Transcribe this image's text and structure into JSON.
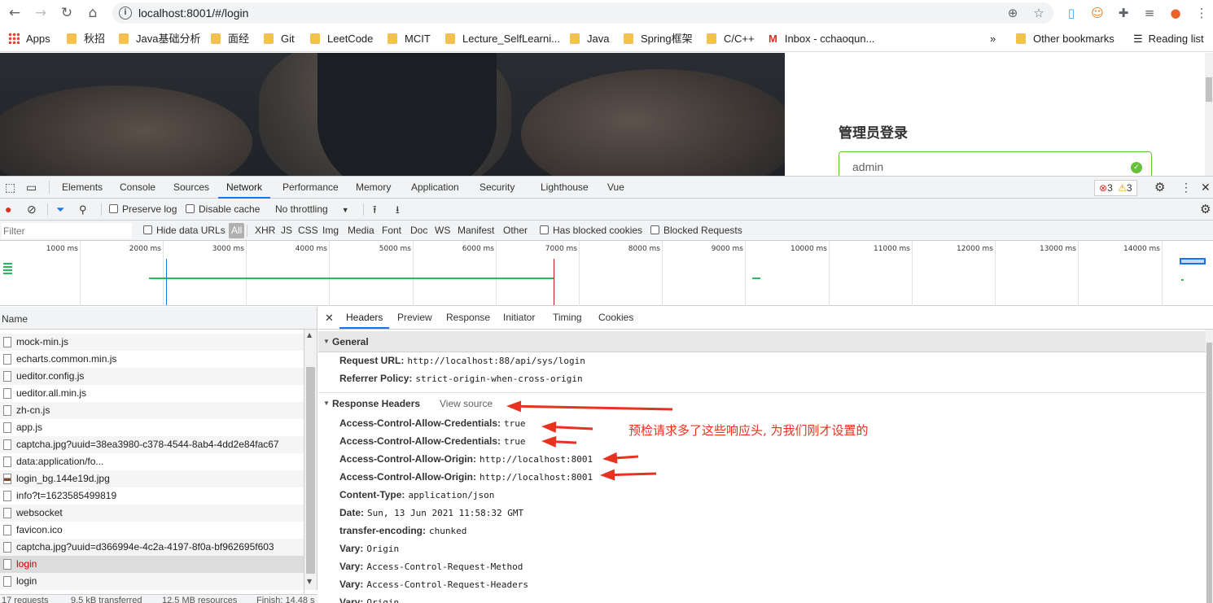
{
  "browser": {
    "url": "localhost:8001/#/login",
    "bookmarks": [
      "Apps",
      "秋招",
      "Java基础分析",
      "面经",
      "Git",
      "LeetCode",
      "MCIT",
      "Lecture_SelfLearni...",
      "Java",
      "Spring框架",
      "C/C++",
      "Inbox - cchaoqun..."
    ],
    "overflow": "»",
    "other_bookmarks": "Other bookmarks",
    "reading_list": "Reading list"
  },
  "page": {
    "login_title": "管理员登录",
    "username_value": "admin"
  },
  "devtools": {
    "tabs": [
      "Elements",
      "Console",
      "Sources",
      "Network",
      "Performance",
      "Memory",
      "Application",
      "Security",
      "Lighthouse",
      "Vue"
    ],
    "active_tab": "Network",
    "errors": "3",
    "warnings": "3",
    "toolbar": {
      "preserve_log": "Preserve log",
      "disable_cache": "Disable cache",
      "throttling": "No throttling"
    },
    "filter": {
      "placeholder": "Filter",
      "hide_data_urls": "Hide data URLs",
      "types": [
        "All",
        "XHR",
        "JS",
        "CSS",
        "Img",
        "Media",
        "Font",
        "Doc",
        "WS",
        "Manifest",
        "Other"
      ],
      "has_blocked_cookies": "Has blocked cookies",
      "blocked_requests": "Blocked Requests"
    },
    "timeline_ticks": [
      "1000 ms",
      "2000 ms",
      "3000 ms",
      "4000 ms",
      "5000 ms",
      "6000 ms",
      "7000 ms",
      "8000 ms",
      "9000 ms",
      "10000 ms",
      "11000 ms",
      "12000 ms",
      "13000 ms",
      "14000 ms"
    ],
    "name_header": "Name",
    "requests": [
      {
        "name": "mock-min.js",
        "type": "file"
      },
      {
        "name": "echarts.common.min.js",
        "type": "file"
      },
      {
        "name": "ueditor.config.js",
        "type": "file"
      },
      {
        "name": "ueditor.all.min.js",
        "type": "file"
      },
      {
        "name": "zh-cn.js",
        "type": "file"
      },
      {
        "name": "app.js",
        "type": "file"
      },
      {
        "name": "captcha.jpg?uuid=38ea3980-c378-4544-8ab4-4dd2e84fac67",
        "type": "file"
      },
      {
        "name": "data:application/fo...",
        "type": "file"
      },
      {
        "name": "login_bg.144e19d.jpg",
        "type": "img"
      },
      {
        "name": "info?t=1623585499819",
        "type": "file"
      },
      {
        "name": "websocket",
        "type": "file"
      },
      {
        "name": "favicon.ico",
        "type": "file"
      },
      {
        "name": "captcha.jpg?uuid=d366994e-4c2a-4197-8f0a-bf962695f603",
        "type": "file"
      },
      {
        "name": "login",
        "type": "error"
      },
      {
        "name": "login",
        "type": "file"
      }
    ],
    "status": {
      "requests": "17 requests",
      "transferred": "9.5 kB transferred",
      "resources": "12.5 MB resources",
      "finish": "Finish: 14.48 s"
    },
    "detail_tabs": [
      "Headers",
      "Preview",
      "Response",
      "Initiator",
      "Timing",
      "Cookies"
    ],
    "active_detail_tab": "Headers",
    "general": {
      "title": "General",
      "rows": [
        {
          "k": "Request URL:",
          "v": "http://localhost:88/api/sys/login"
        },
        {
          "k": "Referrer Policy:",
          "v": "strict-origin-when-cross-origin"
        }
      ]
    },
    "response_headers": {
      "title": "Response Headers",
      "view_source": "View source",
      "rows": [
        {
          "k": "Access-Control-Allow-Credentials:",
          "v": "true"
        },
        {
          "k": "Access-Control-Allow-Credentials:",
          "v": "true"
        },
        {
          "k": "Access-Control-Allow-Origin:",
          "v": "http://localhost:8001"
        },
        {
          "k": "Access-Control-Allow-Origin:",
          "v": "http://localhost:8001"
        },
        {
          "k": "Content-Type:",
          "v": "application/json"
        },
        {
          "k": "Date:",
          "v": "Sun, 13 Jun 2021 11:58:32 GMT"
        },
        {
          "k": "transfer-encoding:",
          "v": "chunked"
        },
        {
          "k": "Vary:",
          "v": "Origin"
        },
        {
          "k": "Vary:",
          "v": "Access-Control-Request-Method"
        },
        {
          "k": "Vary:",
          "v": "Access-Control-Request-Headers"
        },
        {
          "k": "Vary:",
          "v": "Origin"
        }
      ]
    }
  },
  "annotation": {
    "note": "预检请求多了这些响应头, 为我们刚才设置的",
    "color": "#e8321f"
  }
}
